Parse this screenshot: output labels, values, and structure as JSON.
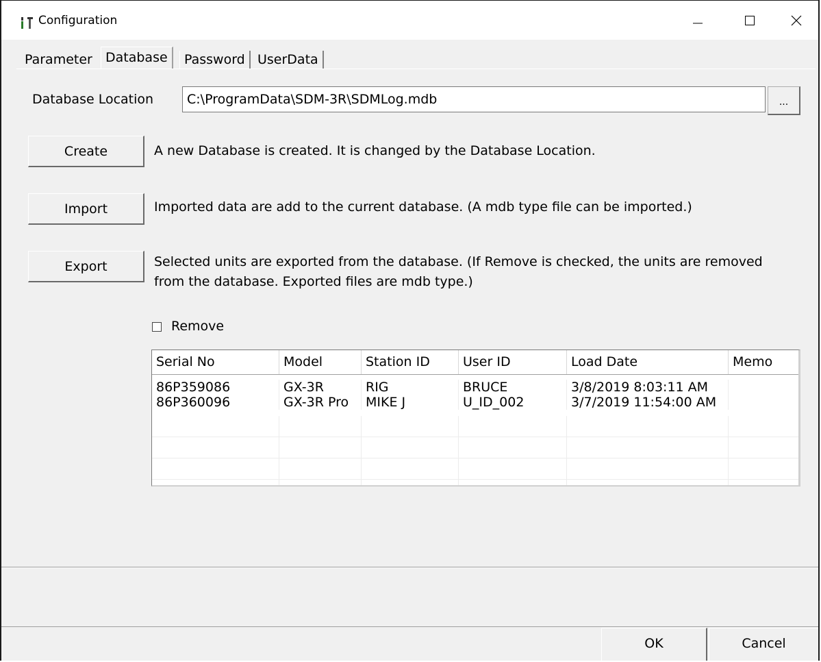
{
  "window": {
    "title": "Configuration",
    "icon": "tools-icon",
    "controls": [
      "minimize-icon",
      "maximize-icon",
      "close-icon"
    ]
  },
  "tabs": [
    {
      "label": "Parameter",
      "active": false
    },
    {
      "label": "Database",
      "active": true
    },
    {
      "label": "Password",
      "active": false
    },
    {
      "label": "UserData",
      "active": false
    }
  ],
  "database": {
    "location_label": "Database Location",
    "location_value": "C:\\ProgramData\\SDM-3R\\SDMLog.mdb",
    "browse_label": "...",
    "create_label": "Create",
    "create_desc": "A new Database is created. It is changed by the Database Location.",
    "import_label": "Import",
    "import_desc": "Imported data are add to the current database. (A mdb type file can be imported.)",
    "export_label": "Export",
    "export_desc_1": "Selected units are exported from the database. (If Remove is checked, the units are removed",
    "export_desc_2": "from the database. Exported files are mdb type.)",
    "remove_label": "Remove",
    "remove_checked": false
  },
  "table": {
    "columns": [
      "Serial No",
      "Model",
      "Station ID",
      "User ID",
      "Load Date",
      "Memo"
    ],
    "rows": [
      [
        "86P359086",
        "GX-3R",
        "RIG",
        "BRUCE",
        "3/8/2019 8:03:11 AM",
        ""
      ],
      [
        "86P360096",
        "GX-3R Pro",
        "MIKE J",
        "U_ID_002",
        "3/7/2019 11:54:00 AM",
        ""
      ]
    ]
  },
  "footer": {
    "ok_label": "OK",
    "cancel_label": "Cancel"
  }
}
